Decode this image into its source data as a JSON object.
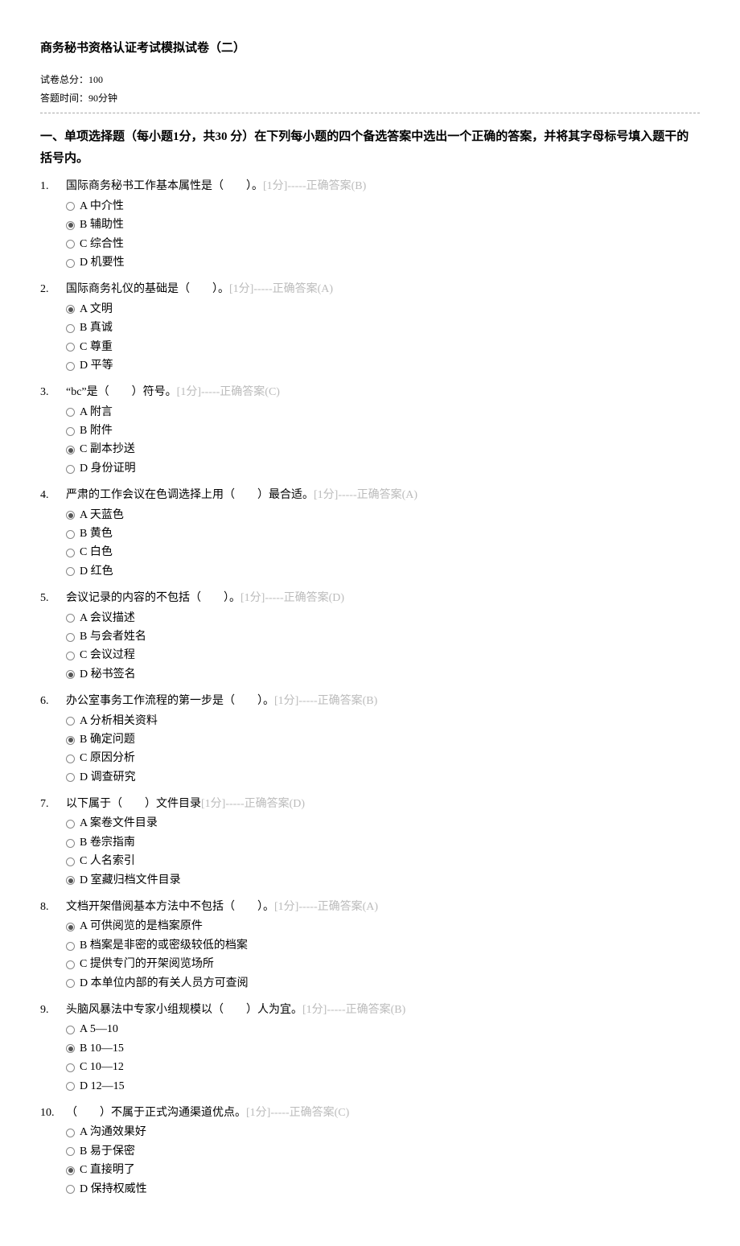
{
  "title": "商务秘书资格认证考试模拟试卷（二）",
  "meta": {
    "total_score": "试卷总分：100",
    "time_limit": "答题时间：90分钟"
  },
  "section_header": "一、单项选择题（每小题1分，共30 分）在下列每小题的四个备选答案中选出一个正确的答案，并将其字母标号填入题干的括号内。",
  "questions": [
    {
      "num": "1.",
      "stem": "国际商务秘书工作基本属性是（　　）。",
      "meta": "[1分]-----正确答案(B)",
      "correct": "B",
      "options": [
        {
          "letter": "A",
          "text": "中介性"
        },
        {
          "letter": "B",
          "text": "辅助性"
        },
        {
          "letter": "C",
          "text": "综合性"
        },
        {
          "letter": "D",
          "text": "机要性"
        }
      ]
    },
    {
      "num": "2.",
      "stem": "国际商务礼仪的基础是（　　）。",
      "meta": "[1分]-----正确答案(A)",
      "correct": "A",
      "options": [
        {
          "letter": "A",
          "text": "文明"
        },
        {
          "letter": "B",
          "text": "真诚"
        },
        {
          "letter": "C",
          "text": "尊重"
        },
        {
          "letter": "D",
          "text": "平等"
        }
      ]
    },
    {
      "num": "3.",
      "stem": "“bc”是（　　）符号。",
      "meta": "[1分]-----正确答案(C)",
      "correct": "C",
      "options": [
        {
          "letter": "A",
          "text": "附言"
        },
        {
          "letter": "B",
          "text": "附件"
        },
        {
          "letter": "C",
          "text": "副本抄送"
        },
        {
          "letter": "D",
          "text": "身份证明"
        }
      ]
    },
    {
      "num": "4.",
      "stem": "严肃的工作会议在色调选择上用（　　）最合适。",
      "meta": "[1分]-----正确答案(A)",
      "correct": "A",
      "options": [
        {
          "letter": "A",
          "text": "天蓝色"
        },
        {
          "letter": "B",
          "text": "黄色"
        },
        {
          "letter": "C",
          "text": "白色"
        },
        {
          "letter": "D",
          "text": "红色"
        }
      ]
    },
    {
      "num": "5.",
      "stem": "会议记录的内容的不包括（　　）。",
      "meta": "[1分]-----正确答案(D)",
      "correct": "D",
      "options": [
        {
          "letter": "A",
          "text": "会议描述"
        },
        {
          "letter": "B",
          "text": "与会者姓名"
        },
        {
          "letter": "C",
          "text": "会议过程"
        },
        {
          "letter": "D",
          "text": "秘书签名"
        }
      ]
    },
    {
      "num": "6.",
      "stem": "办公室事务工作流程的第一步是（　　）。",
      "meta": "[1分]-----正确答案(B)",
      "correct": "B",
      "options": [
        {
          "letter": "A",
          "text": "分析相关资料"
        },
        {
          "letter": "B",
          "text": "确定问题"
        },
        {
          "letter": "C",
          "text": "原因分析"
        },
        {
          "letter": "D",
          "text": "调查研究"
        }
      ]
    },
    {
      "num": "7.",
      "stem": "以下属于（　　）文件目录",
      "meta": "[1分]-----正确答案(D)",
      "correct": "D",
      "options": [
        {
          "letter": "A",
          "text": "案卷文件目录"
        },
        {
          "letter": "B",
          "text": "卷宗指南"
        },
        {
          "letter": "C",
          "text": "人名索引"
        },
        {
          "letter": "D",
          "text": "室藏归档文件目录"
        }
      ]
    },
    {
      "num": "8.",
      "stem": "文档开架借阅基本方法中不包括（　　）。",
      "meta": "[1分]-----正确答案(A)",
      "correct": "A",
      "options": [
        {
          "letter": "A",
          "text": "可供阅览的是档案原件"
        },
        {
          "letter": "B",
          "text": "档案是非密的或密级较低的档案"
        },
        {
          "letter": "C",
          "text": "提供专门的开架阅览场所"
        },
        {
          "letter": "D",
          "text": "本单位内部的有关人员方可查阅"
        }
      ]
    },
    {
      "num": "9.",
      "stem": "头脑风暴法中专家小组规模以（　　）人为宜。",
      "meta": "[1分]-----正确答案(B)",
      "correct": "B",
      "options": [
        {
          "letter": "A",
          "text": "5—10"
        },
        {
          "letter": "B",
          "text": "10—15"
        },
        {
          "letter": "C",
          "text": "10—12"
        },
        {
          "letter": "D",
          "text": "12—15"
        }
      ]
    },
    {
      "num": "10.",
      "stem": "（　　）不属于正式沟通渠道优点。",
      "meta": "[1分]-----正确答案(C)",
      "correct": "C",
      "options": [
        {
          "letter": "A",
          "text": "沟通效果好"
        },
        {
          "letter": "B",
          "text": "易于保密"
        },
        {
          "letter": "C",
          "text": "直接明了"
        },
        {
          "letter": "D",
          "text": "保持权威性"
        }
      ]
    }
  ]
}
